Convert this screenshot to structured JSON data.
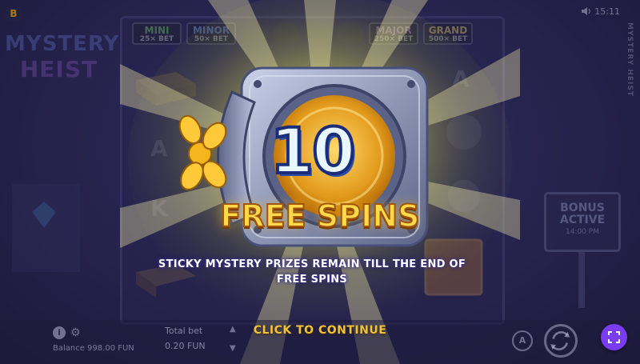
{
  "brand": {
    "letter": "B"
  },
  "logo": {
    "line1": "MYSTERY",
    "line2": "HEIST"
  },
  "status": {
    "clock": "15:11",
    "side_title": "MYSTERY HEIST"
  },
  "jackpots": [
    {
      "name": "MINI",
      "value": "25× BET"
    },
    {
      "name": "MINOR",
      "value": "50× BET"
    },
    {
      "name": "MAJOR",
      "value": "250× BET"
    },
    {
      "name": "GRAND",
      "value": "500× BET"
    }
  ],
  "bonus_sign": {
    "line1": "BONUS",
    "line2": "ACTIVE",
    "sub": "14:00 PM"
  },
  "popup": {
    "count": "10",
    "title": "FREE SPINS",
    "message_line1": "STICKY MYSTERY PRIZES REMAIN TILL THE END OF",
    "message_line2": "FREE SPINS",
    "cta": "CLICK TO CONTINUE"
  },
  "footer": {
    "info_icon": "i",
    "balance": "Balance 998.00 FUN",
    "total_bet_label": "Total bet",
    "total_bet_value": "0.20 FUN",
    "auto_label": "A"
  },
  "colors": {
    "accent": "#7a3cf0",
    "title_gold": "#ffd94a",
    "cta_gold": "#f0c23a",
    "count_fill": "#e8f6ff"
  },
  "icons": [
    "info-icon",
    "gear-icon",
    "sound-icon",
    "spin-arrows-icon",
    "fullscreen-icon",
    "chevron-up-icon",
    "chevron-down-icon"
  ]
}
